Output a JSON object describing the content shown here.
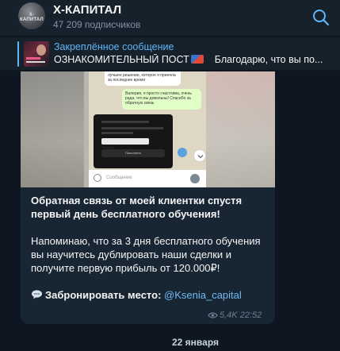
{
  "header": {
    "avatar_text": "Х-КАПИТАЛ",
    "title": "Х-КАПИТАЛ",
    "subscribers": "47 209 подписчиков",
    "search_icon": "search-icon"
  },
  "pinned": {
    "label": "Закреплённое сообщение",
    "title": "ОЗНАКОМИТЕЛЬНЫЙ ПОСТ",
    "preview": "Благодарю, что вы по..."
  },
  "message": {
    "photo": {
      "bubble_top": "лучшее решение, которое я приняла за последнее время",
      "bubble_reply": "Валерия, я просто счастлива, очень рада, что вы довольны! Спасибо за обратную связь",
      "screen_button": "Пополнить",
      "screen_balance": "Баланс",
      "input_placeholder": "Сообщение"
    },
    "headline": "Обратная связь от моей клиентки спустя первый день бесплатного обучения!",
    "body": "Напоминаю, что за 3 дня бесплатного обучения вы научитесь дублировать наши сделки и получите первую прибыль от 120.000₽!",
    "booking_label": "Забронировать место:",
    "booking_link": "@Ksenia_capital",
    "views": "5,4K",
    "time": "22:52"
  },
  "date_separator": "22 января",
  "colors": {
    "background": "#0e1621",
    "panel": "#17212b",
    "bubble": "#182533",
    "accent": "#5eb5f7",
    "link": "#71baf5",
    "muted": "#7f91a4"
  }
}
